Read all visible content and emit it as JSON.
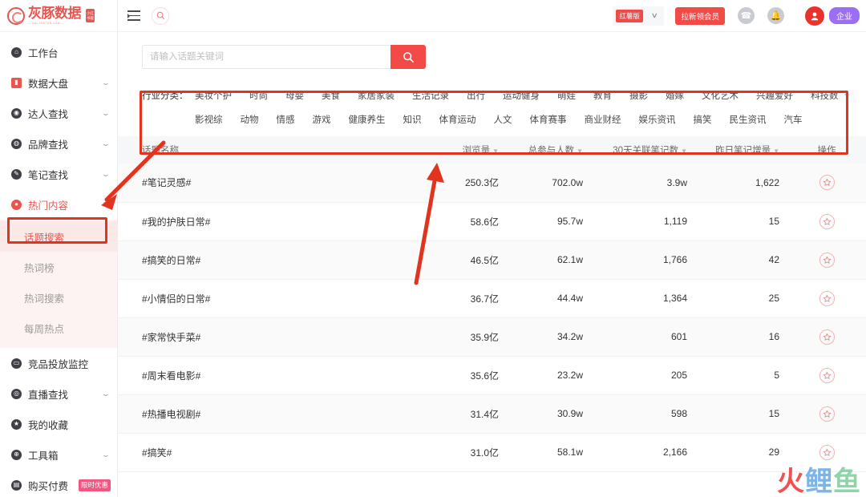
{
  "brand": {
    "logo_text": "灰豚数据",
    "logo_sub": "— DAL.HUITUN.COM —",
    "logo_badge_line1": "小红",
    "logo_badge_line2": "书版"
  },
  "sidebar": {
    "items": [
      {
        "label": "工作台",
        "icon": "home-icon",
        "expandable": false,
        "active": false
      },
      {
        "label": "数据大盘",
        "icon": "chart-icon",
        "expandable": true,
        "active": false
      },
      {
        "label": "达人查找",
        "icon": "user-search-icon",
        "expandable": true,
        "active": false
      },
      {
        "label": "品牌查找",
        "icon": "brand-icon",
        "expandable": true,
        "active": false
      },
      {
        "label": "笔记查找",
        "icon": "note-icon",
        "expandable": true,
        "active": false
      },
      {
        "label": "热门内容",
        "icon": "fire-icon",
        "expandable": true,
        "active": true
      }
    ],
    "submenu": [
      {
        "label": "话题搜索",
        "active": true
      },
      {
        "label": "热词榜",
        "active": false
      },
      {
        "label": "热词搜索",
        "active": false
      },
      {
        "label": "每周热点",
        "active": false
      }
    ],
    "items_bottom": [
      {
        "label": "竞品投放监控",
        "icon": "monitor-icon",
        "expandable": false,
        "badge": ""
      },
      {
        "label": "直播查找",
        "icon": "live-icon",
        "expandable": true,
        "badge": ""
      },
      {
        "label": "我的收藏",
        "icon": "star-icon",
        "expandable": false,
        "badge": ""
      },
      {
        "label": "工具箱",
        "icon": "toolbox-icon",
        "expandable": true,
        "badge": ""
      },
      {
        "label": "购买付费",
        "icon": "cart-icon",
        "expandable": false,
        "badge": "限时优惠"
      }
    ]
  },
  "topbar": {
    "collapse_icon": "collapse-sidebar-icon",
    "search_icon": "search-icon",
    "version_tag": "红薯版",
    "version_caret": "∨",
    "cta_label": "拉新领会员",
    "headset_icon": "headset-icon",
    "bell_icon": "bell-icon",
    "avatar_icon": "avatar-icon",
    "enterprise_badge": "企业"
  },
  "search": {
    "value": "",
    "placeholder": "请输入话题关键词",
    "button_icon": "search-icon"
  },
  "filter": {
    "label": "行业分类：",
    "collapse_icon": "chevron-up-icon",
    "tags": [
      "美妆个护",
      "时尚",
      "母婴",
      "美食",
      "家居家装",
      "生活记录",
      "出行",
      "运动健身",
      "萌娃",
      "教育",
      "摄影",
      "婚嫁",
      "文化艺术",
      "兴趣爱好",
      "科技数码",
      "影视综",
      "动物",
      "情感",
      "游戏",
      "健康养生",
      "知识",
      "体育运动",
      "人文",
      "体育赛事",
      "商业财经",
      "娱乐资讯",
      "搞笑",
      "民生资讯",
      "汽车"
    ]
  },
  "table": {
    "columns": [
      {
        "key": "name",
        "label": "话题名称",
        "sortable": false
      },
      {
        "key": "views",
        "label": "浏览量",
        "sortable": true
      },
      {
        "key": "people",
        "label": "总参与人数",
        "sortable": true
      },
      {
        "key": "notes30",
        "label": "30天关联笔记数",
        "sortable": true
      },
      {
        "key": "delta",
        "label": "昨日笔记增量",
        "sortable": true
      },
      {
        "key": "op",
        "label": "操作",
        "sortable": false
      }
    ],
    "rows": [
      {
        "name": "#笔记灵感#",
        "views": "250.3亿",
        "people": "702.0w",
        "notes30": "3.9w",
        "delta": "1,622",
        "fav_icon": "star-circle-icon"
      },
      {
        "name": "#我的护肤日常#",
        "views": "58.6亿",
        "people": "95.7w",
        "notes30": "1,119",
        "delta": "15",
        "fav_icon": "star-circle-icon"
      },
      {
        "name": "#搞笑的日常#",
        "views": "46.5亿",
        "people": "62.1w",
        "notes30": "1,766",
        "delta": "42",
        "fav_icon": "star-circle-icon"
      },
      {
        "name": "#小情侣的日常#",
        "views": "36.7亿",
        "people": "44.4w",
        "notes30": "1,364",
        "delta": "25",
        "fav_icon": "star-circle-icon"
      },
      {
        "name": "#家常快手菜#",
        "views": "35.9亿",
        "people": "34.2w",
        "notes30": "601",
        "delta": "16",
        "fav_icon": "star-circle-icon"
      },
      {
        "name": "#周末看电影#",
        "views": "35.6亿",
        "people": "23.2w",
        "notes30": "205",
        "delta": "5",
        "fav_icon": "star-circle-icon"
      },
      {
        "name": "#热播电视剧#",
        "views": "31.4亿",
        "people": "30.9w",
        "notes30": "598",
        "delta": "15",
        "fav_icon": "star-circle-icon"
      },
      {
        "name": "#搞笑#",
        "views": "31.0亿",
        "people": "58.1w",
        "notes30": "2,166",
        "delta": "29",
        "fav_icon": "star-circle-icon"
      }
    ]
  },
  "watermark": {
    "part1": "火",
    "part2": "鲤",
    "part3": "鱼"
  },
  "colors": {
    "brand_red": "#e8564f",
    "cta_red": "#f24a46",
    "annotation_red": "#e1341e",
    "enterprise_purple": "#9b6ef3",
    "hot_badge_pink": "#f2557f",
    "active_bg": "#fbe9e7"
  }
}
